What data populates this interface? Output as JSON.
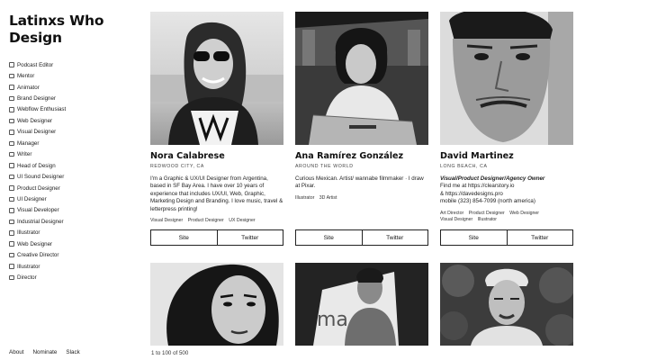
{
  "site": {
    "title_line1": "Latinxs Who",
    "title_line2": "Design"
  },
  "filters": [
    "Podcast Editor",
    "Mentor",
    "Animator",
    "Brand Designer",
    "Webflow Enthusiast",
    "Web Designer",
    "Visual Designer",
    "Manager",
    "Writer",
    "Head of Design",
    "UI Sound Designer",
    "Product Designer",
    "UI Designer",
    "Visual Developer",
    "Industrial Designer",
    "Illustrator",
    "Web Designer",
    "Creative Director",
    "Illustrator",
    "Director"
  ],
  "footer": {
    "about": "About",
    "nominate": "Nominate",
    "slack": "Slack"
  },
  "cards": [
    {
      "name": "Nora Calabrese",
      "location": "Redwood City, CA",
      "bio": "I'm a Graphic & UX/UI Designer from Argentina, based in SF Bay Area. I have over 10 years of experience that includes UX/UI, Web, Graphic, Marketing Design and Branding. I love music, travel & letterpress printing!",
      "tags": [
        "Visual Designer",
        "Product Designer",
        "UX Designer"
      ],
      "site_label": "Site",
      "twitter_label": "Twitter"
    },
    {
      "name": "Ana Ramírez González",
      "location": "Around the World",
      "bio": "Curious Mexican. Artist/ wannabe filmmaker · I draw at Pixar.",
      "tags": [
        "Illustrator",
        "3D Artist"
      ],
      "site_label": "Site",
      "twitter_label": "Twitter"
    },
    {
      "name": "David Martinez",
      "location": "Long Beach, CA",
      "bio_strong": "Visual/Product Designer/Agency Owner",
      "bio_line1": "Find me at https://clearstory.io",
      "bio_line2": "& https://davedesigns.pro",
      "bio_line3": "mobile (323) 854-7099 (north america)",
      "tags": [
        "Art Director",
        "Product Designer",
        "Web Designer",
        "Visual Designer",
        "Illustrator"
      ],
      "site_label": "Site",
      "twitter_label": "Twitter"
    }
  ],
  "pagination": "1 to 100 of 500",
  "colors": {
    "text": "#111111",
    "border": "#222222",
    "photo_dark": "#2a2a2a",
    "photo_light": "#d8d8d8"
  }
}
